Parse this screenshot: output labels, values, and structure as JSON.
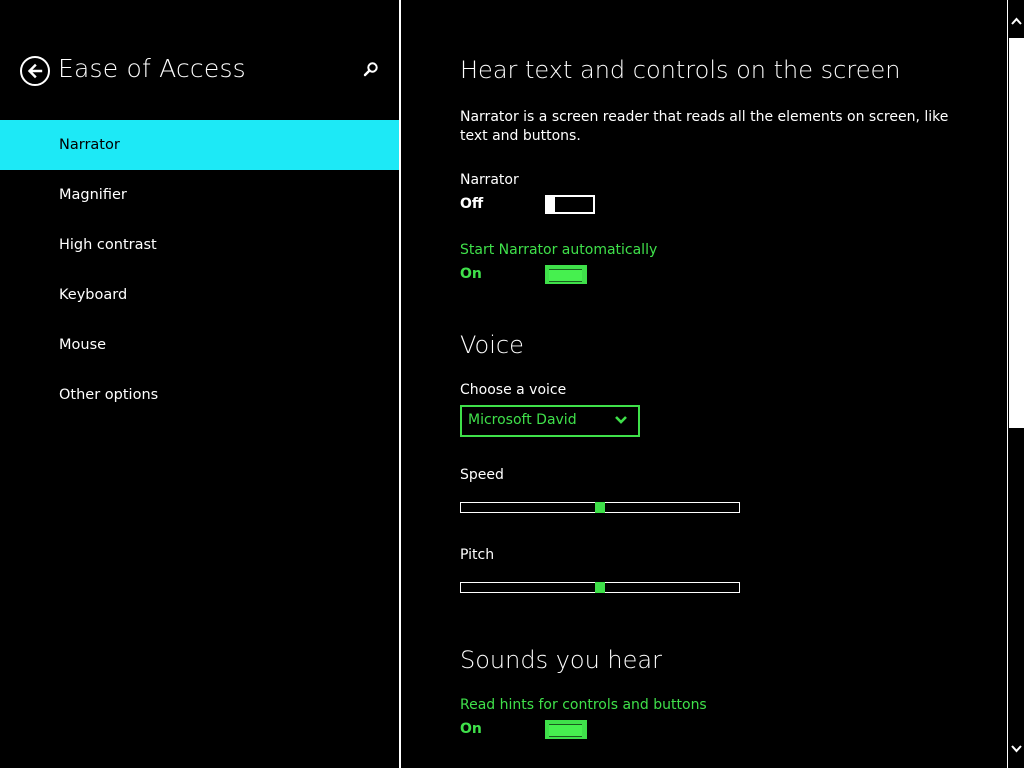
{
  "nav": {
    "title": "Ease of Access",
    "items": [
      {
        "label": "Narrator",
        "active": true
      },
      {
        "label": "Magnifier"
      },
      {
        "label": "High contrast"
      },
      {
        "label": "Keyboard"
      },
      {
        "label": "Mouse"
      },
      {
        "label": "Other options"
      }
    ]
  },
  "main": {
    "heading": "Hear text and controls on the screen",
    "description": "Narrator is a screen reader that reads all the elements on screen, like text and buttons.",
    "narrator": {
      "label": "Narrator",
      "state": "Off"
    },
    "auto_start": {
      "label": "Start Narrator automatically",
      "state": "On"
    },
    "voice_section": {
      "heading": "Voice",
      "choose_label": "Choose a voice",
      "selected_voice": "Microsoft David",
      "speed_label": "Speed",
      "speed_value": 0.5,
      "pitch_label": "Pitch",
      "pitch_value": 0.5
    },
    "sounds_section": {
      "heading": "Sounds you hear",
      "hints_label": "Read hints for controls and buttons",
      "hints_state": "On"
    }
  },
  "colors": {
    "accent_green": "#3fe04a",
    "selection_cyan": "#1de9f6",
    "background": "#000000",
    "text": "#ffffff"
  },
  "icons": {
    "back": "arrow-left-circle-icon",
    "search": "search-icon",
    "dropdown": "chevron-down-icon",
    "scroll_up": "chevron-up-icon",
    "scroll_down": "chevron-down-icon"
  }
}
